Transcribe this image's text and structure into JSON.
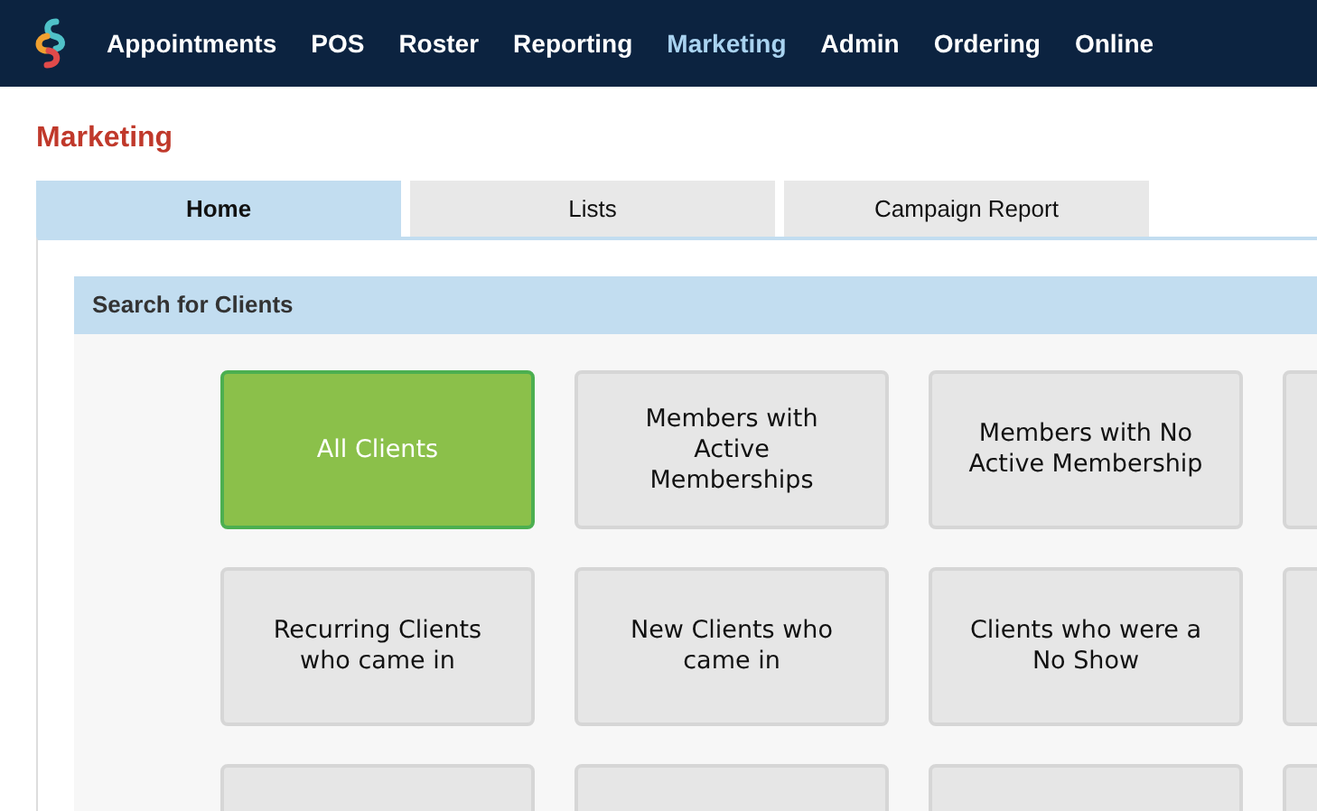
{
  "nav": {
    "items": [
      {
        "label": "Appointments",
        "selected": false
      },
      {
        "label": "POS",
        "selected": false
      },
      {
        "label": "Roster",
        "selected": false
      },
      {
        "label": "Reporting",
        "selected": false
      },
      {
        "label": "Marketing",
        "selected": true
      },
      {
        "label": "Admin",
        "selected": false
      },
      {
        "label": "Ordering",
        "selected": false
      },
      {
        "label": "Online",
        "selected": false
      }
    ]
  },
  "page_title": "Marketing",
  "tabs": [
    {
      "label": "Home",
      "selected": true
    },
    {
      "label": "Lists",
      "selected": false
    },
    {
      "label": "Campaign Report",
      "selected": false
    }
  ],
  "section": {
    "title": "Search for Clients",
    "tiles": [
      {
        "label": "All Clients",
        "selected": true
      },
      {
        "label": "Members with Active Memberships",
        "selected": false
      },
      {
        "label": "Members with No Active Membership",
        "selected": false
      },
      {
        "label": "Recurring Clients who came in",
        "selected": false
      },
      {
        "label": "New Clients who came in",
        "selected": false
      },
      {
        "label": "Clients who were a No Show",
        "selected": false
      }
    ]
  }
}
